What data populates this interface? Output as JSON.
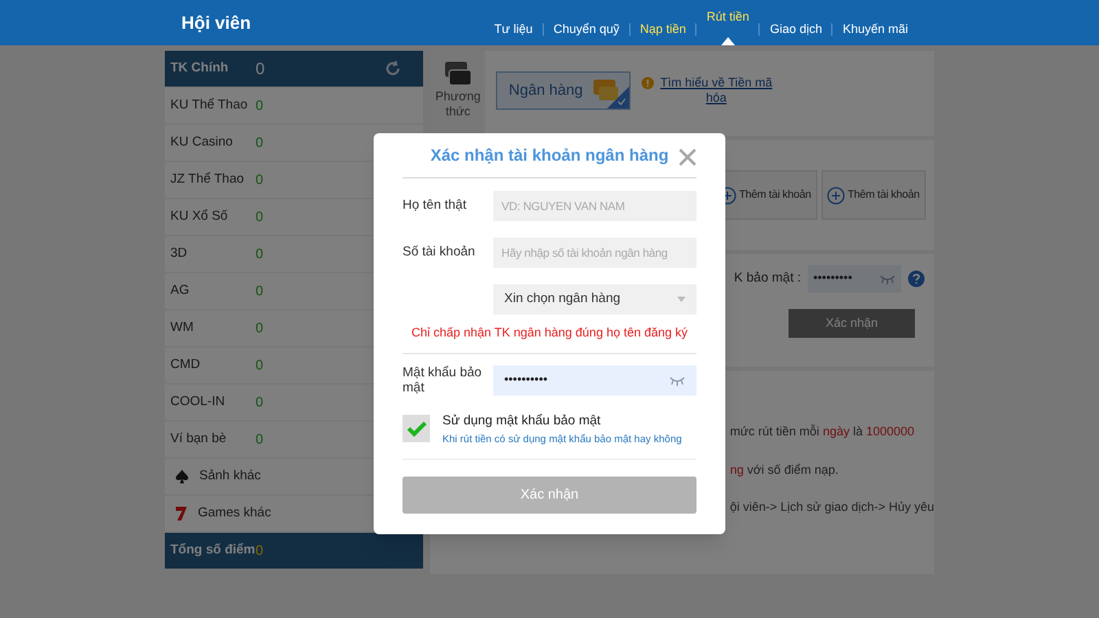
{
  "header": {
    "title": "Hội viên",
    "nav": [
      {
        "label": "Tư liệu",
        "selected": false,
        "highlight": false
      },
      {
        "label": "Chuyển quỹ",
        "selected": false,
        "highlight": false
      },
      {
        "label": "Nạp tiền",
        "selected": false,
        "highlight": true
      },
      {
        "label": "Rút tiền",
        "selected": true,
        "highlight": true
      },
      {
        "label": "Giao dịch",
        "selected": false,
        "highlight": false
      },
      {
        "label": "Khuyến mãi",
        "selected": false,
        "highlight": false
      }
    ]
  },
  "sidebar": {
    "items": [
      {
        "kind": "main",
        "label": "TK Chính",
        "value": "0"
      },
      {
        "kind": "game",
        "label": "KU Thể Thao",
        "value": "0"
      },
      {
        "kind": "game",
        "label": "KU Casino",
        "value": "0"
      },
      {
        "kind": "game",
        "label": "JZ Thể Thao",
        "value": "0"
      },
      {
        "kind": "game",
        "label": "KU Xổ Số",
        "value": "0"
      },
      {
        "kind": "game",
        "label": "3D",
        "value": "0"
      },
      {
        "kind": "game",
        "label": "AG",
        "value": "0"
      },
      {
        "kind": "game",
        "label": "WM",
        "value": "0"
      },
      {
        "kind": "game",
        "label": "CMD",
        "value": "0"
      },
      {
        "kind": "game",
        "label": "COOL-IN",
        "value": "0"
      },
      {
        "kind": "game",
        "label": "Ví bạn bè",
        "value": "0"
      },
      {
        "kind": "spade",
        "label": "Sảnh khác"
      },
      {
        "kind": "seven",
        "label": "Games khác"
      },
      {
        "kind": "total",
        "label": "Tổng số điểm",
        "value": "0"
      }
    ]
  },
  "method": {
    "label": "Phương thức",
    "option": "Ngân hàng",
    "link": "Tìm hiểu về Tiền mã hóa"
  },
  "accounts": [
    "Thêm tài khoản",
    "Thêm tài khoản"
  ],
  "withdraw": {
    "password_label": "K bảo mật :",
    "password_value": "•••••••••",
    "button": "Xác nhận"
  },
  "notes": [
    [
      {
        "text": "mức rút tiền mỗi ",
        "red": false
      },
      {
        "text": "ngày",
        "red": true
      },
      {
        "text": " là ",
        "red": false
      },
      {
        "text": "1000000",
        "red": true
      }
    ],
    [
      {
        "text": "ng",
        "red": true
      },
      {
        "text": " với số điểm nạp.",
        "red": false
      }
    ],
    [
      {
        "text": "ội viên-> Lịch sử giao dịch-> Hủy yêu",
        "red": false
      }
    ]
  ],
  "dialog": {
    "title": "Xác nhận tài khoản ngân hàng",
    "fields": [
      {
        "kind": "text",
        "label": "Họ tên thật",
        "placeholder": "VD: NGUYEN VAN NAM"
      },
      {
        "kind": "text",
        "label": "Số tài khoản",
        "placeholder": "Hãy nhập số tài khoản ngân hàng"
      },
      {
        "kind": "select",
        "value": "Xin chọn ngân hàng"
      }
    ],
    "warning": "Chỉ chấp nhận TK ngân hàng đúng họ tên đăng ký",
    "password": {
      "label": "Mật khẩu bảo mật",
      "value": "••••••••••"
    },
    "use_password": {
      "checked": true,
      "label": "Sử dụng mật khẩu bảo mật",
      "hint": "Khi rút tiền có sử dụng mật khẩu bảo mật hay không"
    },
    "submit": "Xác nhận"
  }
}
